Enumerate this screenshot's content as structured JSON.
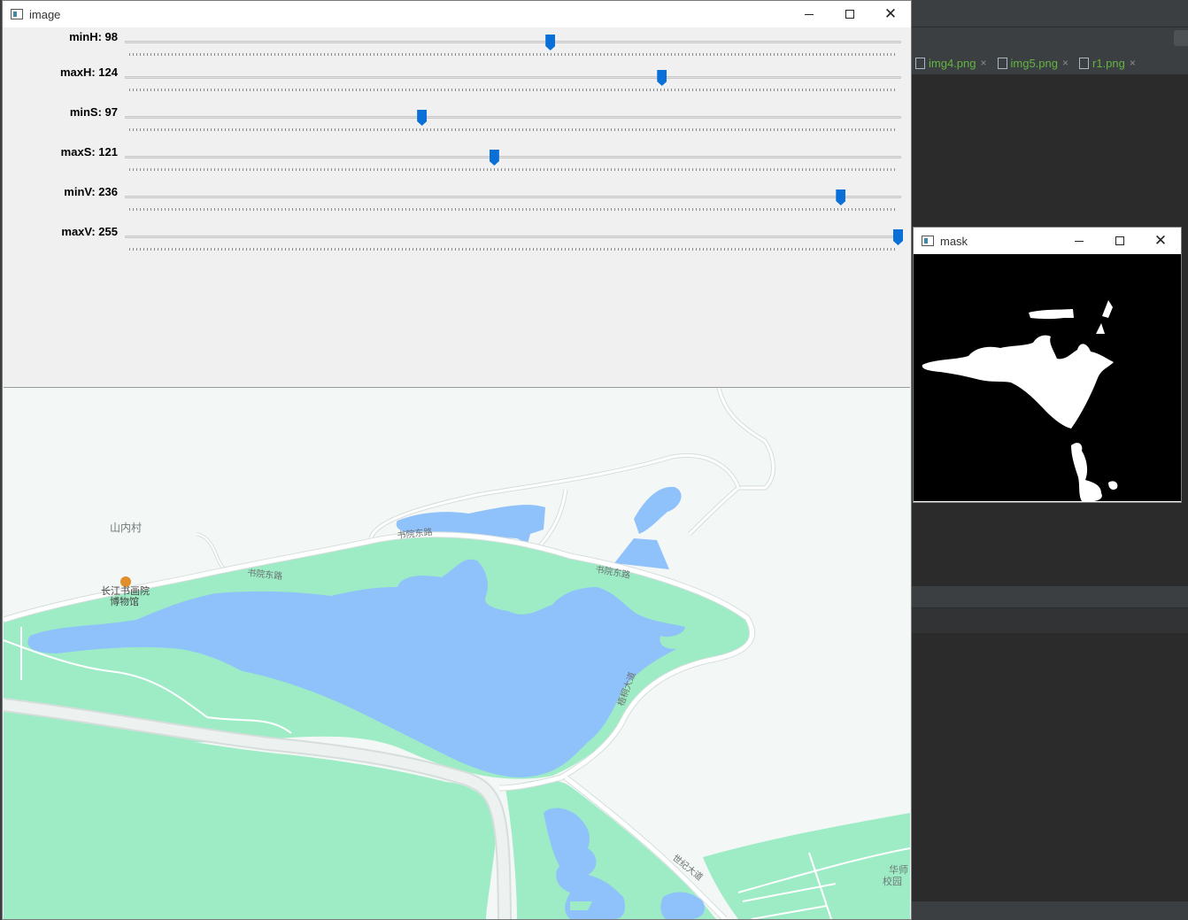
{
  "image_window": {
    "title": "image",
    "trackbars": [
      {
        "label": "minH: 98",
        "value": 98,
        "max": 179
      },
      {
        "label": "maxH: 124",
        "value": 124,
        "max": 179
      },
      {
        "label": "minS: 97",
        "value": 97,
        "max": 255
      },
      {
        "label": "maxS: 121",
        "value": 121,
        "max": 255
      },
      {
        "label": "minV: 236",
        "value": 236,
        "max": 255
      },
      {
        "label": "maxV: 255",
        "value": 255,
        "max": 255
      }
    ],
    "map": {
      "village_label": "山内村",
      "museum_label_line1": "长江书画院",
      "museum_label_line2": "博物馆",
      "road_labels": [
        "书院东路",
        "书院东路",
        "书院东路",
        "梧桐大道",
        "世纪大道"
      ],
      "corner_label_1": "华师",
      "corner_label_2": "校园",
      "colors": {
        "land": "#f3f7f6",
        "green": "#9decc5",
        "water": "#8fc1fb",
        "road": "#ffffff",
        "road_edge": "#d6dedc"
      }
    }
  },
  "mask_window": {
    "title": "mask",
    "colors": {
      "background": "#000000",
      "foreground": "#ffffff"
    }
  },
  "ide": {
    "tabs": [
      {
        "name": "img4.png",
        "close": "×"
      },
      {
        "name": "img5.png",
        "close": "×"
      },
      {
        "name": "r1.png",
        "close": "×"
      }
    ]
  }
}
